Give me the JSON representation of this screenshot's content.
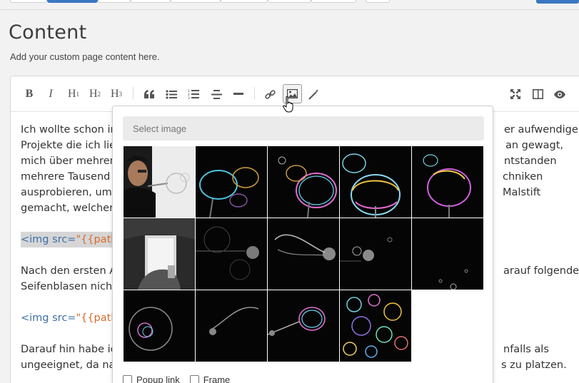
{
  "page": {
    "title": "Content",
    "subtitle": "Add your custom page content here."
  },
  "toolbar": {
    "bold": "B",
    "italic": "I",
    "h1": "H1",
    "h2": "H2",
    "h3": "H3",
    "icons": [
      "bold-icon",
      "italic-icon",
      "heading-1-icon",
      "heading-2-icon",
      "heading-3-icon",
      "quote-icon",
      "unordered-list-icon",
      "ordered-list-icon",
      "align-center-icon",
      "horizontal-rule-icon",
      "link-icon",
      "image-icon",
      "magic-wand-icon",
      "fullscreen-icon",
      "side-by-side-icon",
      "preview-icon"
    ]
  },
  "content": {
    "p1_lines_left": [
      "Ich wollte schon im",
      "Projekte die ich lieb",
      "mich über mehrere",
      "mehrere Tausend Fo",
      "ausprobieren, um d",
      "gemacht, welcher s"
    ],
    "p1_lines_right": [
      "er aufwendigen",
      "an gewagt,",
      "ntstanden",
      "chniken",
      "Malstift"
    ],
    "code1_tag": "<img src=",
    "code1_str": "\"{{path}}I",
    "p2_lines_left": [
      "Nach den ersten An",
      "Seifenblasen nicht r"
    ],
    "p2_lines_right": [
      "arauf folgenden"
    ],
    "code2_tag": "<img src=",
    "code2_str": "\"{{path}}I",
    "p3_lines_left": [
      "Darauf hin habe ich",
      "ungeeignet, da nach"
    ],
    "p3_lines_right": [
      "nfalls als",
      "s zu platzen."
    ]
  },
  "image_picker": {
    "placeholder": "Select image",
    "images": [
      "photographer-with-bubble-wand-image",
      "bubble-image-2",
      "bubble-image-3",
      "bubble-image-4",
      "bubble-image-5",
      "studio-setup-image",
      "bubble-image-7",
      "bubble-image-8",
      "bubble-image-9",
      "bubble-image-10",
      "bubble-image-11",
      "bubble-image-12",
      "bubble-image-13",
      "bubble-cluster-image"
    ],
    "option_popup": "Popup link",
    "option_frame": "Frame"
  },
  "colors": {
    "accent": "#3a78c2",
    "code_tag": "#3d6fa8",
    "code_string": "#d86a2a"
  }
}
